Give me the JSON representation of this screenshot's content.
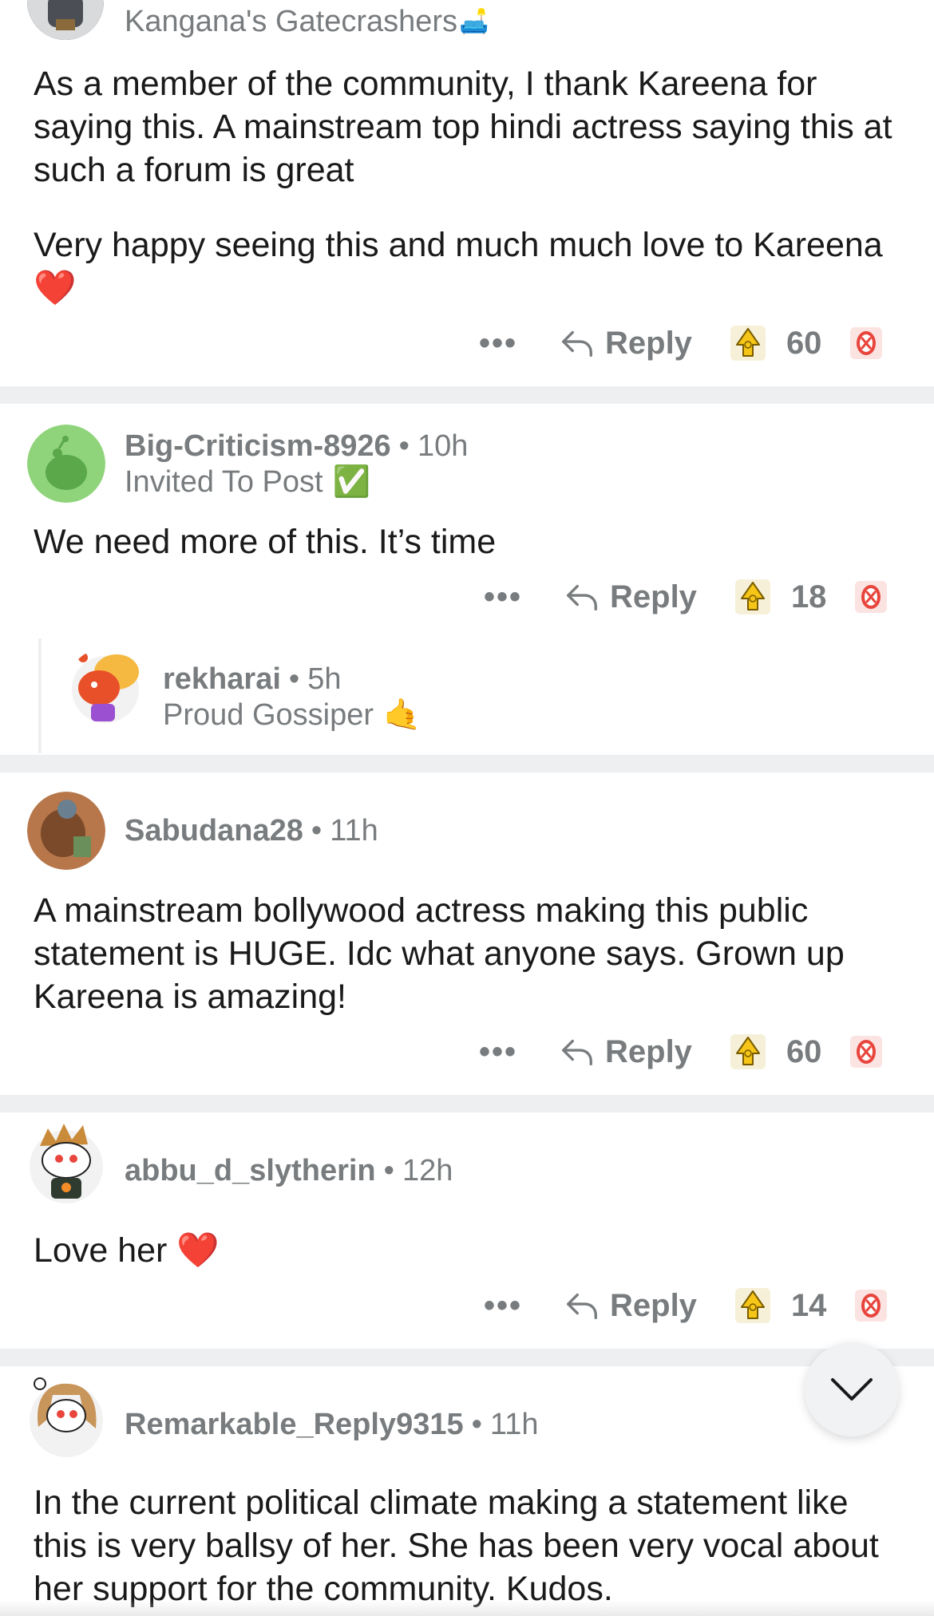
{
  "comments": [
    {
      "author": "",
      "age": "",
      "flair": "Kangana's Gatecrashers",
      "flair_emoji": "🛋️",
      "body": [
        "As a member of the community, I thank Kareena for saying this. A mainstream top hindi actress saying this at such a forum is great",
        "Very happy seeing this and much much love to Kareena ❤️"
      ],
      "reply_label": "Reply",
      "score": "60"
    },
    {
      "author": "Big-Criticism-8926",
      "age": "10h",
      "flair": "Invited To Post",
      "flair_emoji": "✅",
      "body": [
        "We need more of this. It’s time"
      ],
      "reply_label": "Reply",
      "score": "18"
    },
    {
      "author": "rekharai",
      "age": "5h",
      "flair": "Proud Gossiper",
      "flair_emoji": "🤙"
    },
    {
      "author": "Sabudana28",
      "age": "11h",
      "body": [
        "A mainstream bollywood actress making this public statement is HUGE. Idc what anyone says. Grown up Kareena is amazing!"
      ],
      "reply_label": "Reply",
      "score": "60"
    },
    {
      "author": "abbu_d_slytherin",
      "age": "12h",
      "body": [
        "Love her ❤️"
      ],
      "reply_label": "Reply",
      "score": "14"
    },
    {
      "author": "Remarkable_Reply9315",
      "age": "11h",
      "body": [
        "In the current political climate making a statement like this is very ballsy of her. She has been very vocal about her support for the community. Kudos."
      ]
    }
  ],
  "separator": "•",
  "more_label": "•••",
  "icons": {
    "more": "more-icon",
    "reply": "reply-arrow-icon",
    "upvote": "award-upvote-icon",
    "downvote": "downvote-icon",
    "scroll": "chevron-down-icon"
  },
  "colors": {
    "background": "#ffffff",
    "separator": "#edeff1",
    "meta_text": "#787c7e",
    "body_text": "#1a1a1b",
    "upvote_gold": "#f5c518",
    "downvote_red": "#e8453c"
  }
}
